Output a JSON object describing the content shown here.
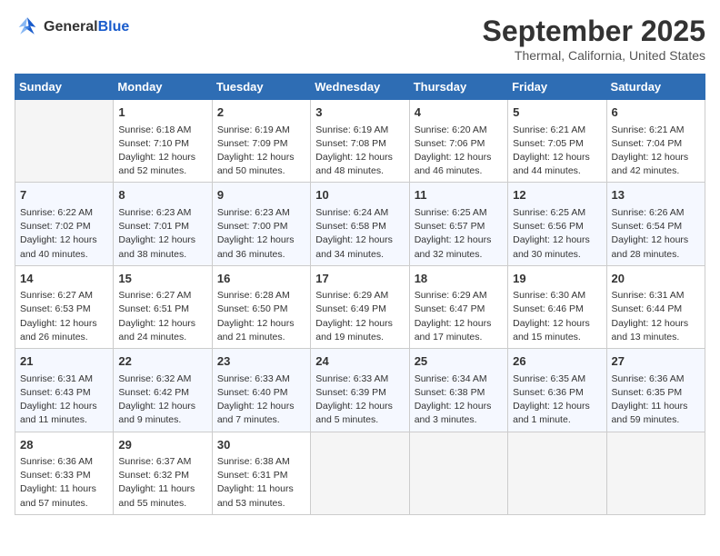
{
  "header": {
    "logo_line1": "General",
    "logo_line2": "Blue",
    "month": "September 2025",
    "location": "Thermal, California, United States"
  },
  "weekdays": [
    "Sunday",
    "Monday",
    "Tuesday",
    "Wednesday",
    "Thursday",
    "Friday",
    "Saturday"
  ],
  "weeks": [
    [
      {
        "day": "",
        "empty": true
      },
      {
        "day": "1",
        "sunrise": "6:18 AM",
        "sunset": "7:10 PM",
        "daylight": "12 hours and 52 minutes."
      },
      {
        "day": "2",
        "sunrise": "6:19 AM",
        "sunset": "7:09 PM",
        "daylight": "12 hours and 50 minutes."
      },
      {
        "day": "3",
        "sunrise": "6:19 AM",
        "sunset": "7:08 PM",
        "daylight": "12 hours and 48 minutes."
      },
      {
        "day": "4",
        "sunrise": "6:20 AM",
        "sunset": "7:06 PM",
        "daylight": "12 hours and 46 minutes."
      },
      {
        "day": "5",
        "sunrise": "6:21 AM",
        "sunset": "7:05 PM",
        "daylight": "12 hours and 44 minutes."
      },
      {
        "day": "6",
        "sunrise": "6:21 AM",
        "sunset": "7:04 PM",
        "daylight": "12 hours and 42 minutes."
      }
    ],
    [
      {
        "day": "7",
        "sunrise": "6:22 AM",
        "sunset": "7:02 PM",
        "daylight": "12 hours and 40 minutes."
      },
      {
        "day": "8",
        "sunrise": "6:23 AM",
        "sunset": "7:01 PM",
        "daylight": "12 hours and 38 minutes."
      },
      {
        "day": "9",
        "sunrise": "6:23 AM",
        "sunset": "7:00 PM",
        "daylight": "12 hours and 36 minutes."
      },
      {
        "day": "10",
        "sunrise": "6:24 AM",
        "sunset": "6:58 PM",
        "daylight": "12 hours and 34 minutes."
      },
      {
        "day": "11",
        "sunrise": "6:25 AM",
        "sunset": "6:57 PM",
        "daylight": "12 hours and 32 minutes."
      },
      {
        "day": "12",
        "sunrise": "6:25 AM",
        "sunset": "6:56 PM",
        "daylight": "12 hours and 30 minutes."
      },
      {
        "day": "13",
        "sunrise": "6:26 AM",
        "sunset": "6:54 PM",
        "daylight": "12 hours and 28 minutes."
      }
    ],
    [
      {
        "day": "14",
        "sunrise": "6:27 AM",
        "sunset": "6:53 PM",
        "daylight": "12 hours and 26 minutes."
      },
      {
        "day": "15",
        "sunrise": "6:27 AM",
        "sunset": "6:51 PM",
        "daylight": "12 hours and 24 minutes."
      },
      {
        "day": "16",
        "sunrise": "6:28 AM",
        "sunset": "6:50 PM",
        "daylight": "12 hours and 21 minutes."
      },
      {
        "day": "17",
        "sunrise": "6:29 AM",
        "sunset": "6:49 PM",
        "daylight": "12 hours and 19 minutes."
      },
      {
        "day": "18",
        "sunrise": "6:29 AM",
        "sunset": "6:47 PM",
        "daylight": "12 hours and 17 minutes."
      },
      {
        "day": "19",
        "sunrise": "6:30 AM",
        "sunset": "6:46 PM",
        "daylight": "12 hours and 15 minutes."
      },
      {
        "day": "20",
        "sunrise": "6:31 AM",
        "sunset": "6:44 PM",
        "daylight": "12 hours and 13 minutes."
      }
    ],
    [
      {
        "day": "21",
        "sunrise": "6:31 AM",
        "sunset": "6:43 PM",
        "daylight": "12 hours and 11 minutes."
      },
      {
        "day": "22",
        "sunrise": "6:32 AM",
        "sunset": "6:42 PM",
        "daylight": "12 hours and 9 minutes."
      },
      {
        "day": "23",
        "sunrise": "6:33 AM",
        "sunset": "6:40 PM",
        "daylight": "12 hours and 7 minutes."
      },
      {
        "day": "24",
        "sunrise": "6:33 AM",
        "sunset": "6:39 PM",
        "daylight": "12 hours and 5 minutes."
      },
      {
        "day": "25",
        "sunrise": "6:34 AM",
        "sunset": "6:38 PM",
        "daylight": "12 hours and 3 minutes."
      },
      {
        "day": "26",
        "sunrise": "6:35 AM",
        "sunset": "6:36 PM",
        "daylight": "12 hours and 1 minute."
      },
      {
        "day": "27",
        "sunrise": "6:36 AM",
        "sunset": "6:35 PM",
        "daylight": "11 hours and 59 minutes."
      }
    ],
    [
      {
        "day": "28",
        "sunrise": "6:36 AM",
        "sunset": "6:33 PM",
        "daylight": "11 hours and 57 minutes."
      },
      {
        "day": "29",
        "sunrise": "6:37 AM",
        "sunset": "6:32 PM",
        "daylight": "11 hours and 55 minutes."
      },
      {
        "day": "30",
        "sunrise": "6:38 AM",
        "sunset": "6:31 PM",
        "daylight": "11 hours and 53 minutes."
      },
      {
        "day": "",
        "empty": true
      },
      {
        "day": "",
        "empty": true
      },
      {
        "day": "",
        "empty": true
      },
      {
        "day": "",
        "empty": true
      }
    ]
  ],
  "labels": {
    "sunrise_prefix": "Sunrise: ",
    "sunset_prefix": "Sunset: ",
    "daylight_prefix": "Daylight: "
  }
}
